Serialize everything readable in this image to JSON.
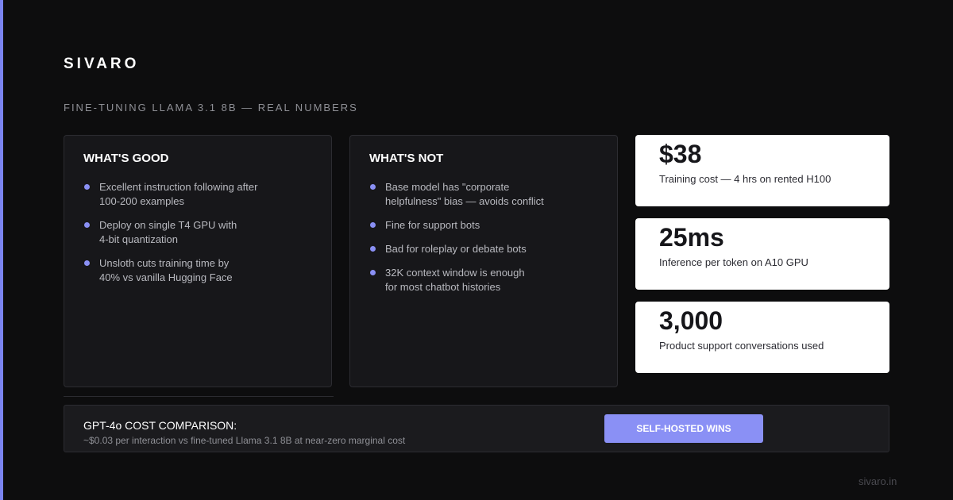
{
  "brand": "SIVARO",
  "subtitle": "FINE-TUNING LLAMA 3.1 8B — REAL NUMBERS",
  "good": {
    "title": "WHAT'S GOOD",
    "items": [
      {
        "line1": "Excellent instruction following after",
        "line2": "100-200 examples"
      },
      {
        "line1": "Deploy on single T4 GPU with",
        "line2": "4-bit quantization"
      },
      {
        "line1": "Unsloth cuts training time by",
        "line2": "40% vs vanilla Hugging Face"
      }
    ]
  },
  "not": {
    "title": "WHAT'S NOT",
    "items": [
      {
        "line1": "Base model has \"corporate",
        "line2": "helpfulness\" bias — avoids conflict"
      },
      {
        "line1": "Fine for support bots",
        "line2": ""
      },
      {
        "line1": "Bad for roleplay or debate bots",
        "line2": ""
      },
      {
        "line1": "32K context window is enough",
        "line2": "for most chatbot histories"
      }
    ]
  },
  "stats": [
    {
      "value": "$38",
      "label": "Training cost — 4 hrs on rented H100"
    },
    {
      "value": "25ms",
      "label": "Inference per token on A10 GPU"
    },
    {
      "value": "3,000",
      "label": "Product support conversations used"
    }
  ],
  "comparison": {
    "title": "GPT-4o COST COMPARISON:",
    "detail": "~$0.03 per interaction vs fine-tuned Llama 3.1 8B at near-zero marginal cost",
    "button_label": "SELF-HOSTED WINS"
  },
  "footer": "sivaro.in",
  "colors": {
    "accent": "#8a90f5",
    "background": "#0d0d0e",
    "card": "#17171a",
    "stat_card": "#ffffff"
  }
}
